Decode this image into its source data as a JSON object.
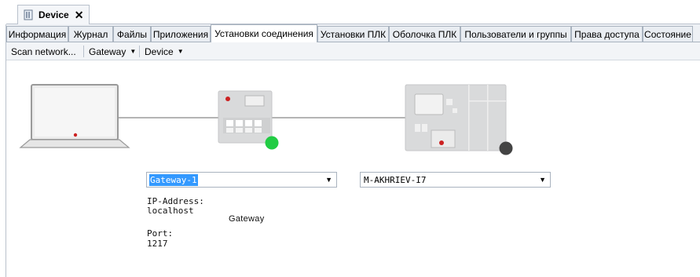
{
  "document_tab": {
    "title": "Device",
    "close_glyph": "✕",
    "icon": "device-page-icon"
  },
  "tabs": [
    {
      "label": "Информация",
      "active": false
    },
    {
      "label": "Журнал",
      "active": false
    },
    {
      "label": "Файлы",
      "active": false
    },
    {
      "label": "Приложения",
      "active": false
    },
    {
      "label": "Установки соединения",
      "active": true
    },
    {
      "label": "Установки ПЛК",
      "active": false
    },
    {
      "label": "Оболочка ПЛК",
      "active": false
    },
    {
      "label": "Пользователи и группы",
      "active": false
    },
    {
      "label": "Права доступа",
      "active": false
    },
    {
      "label": "Состояние",
      "active": false
    }
  ],
  "toolbar": {
    "scan_label": "Scan network...",
    "gateway_label": "Gateway",
    "device_label": "Device"
  },
  "topology": {
    "gateway_name": "Gateway",
    "gateway_status_color": "#22cc44",
    "device_status_color": "#444444",
    "gateway_combo": {
      "value": "Gateway-1"
    },
    "device_combo": {
      "value": "M-AKHRIEV-I7"
    },
    "gateway_info": {
      "ip_label": "IP-Address:",
      "ip_value": "localhost",
      "port_label": "Port:",
      "port_value": "1217"
    }
  },
  "colors": {
    "selection": "#3399ff",
    "device_body": "#d9dadb",
    "led_red": "#cc2222"
  }
}
